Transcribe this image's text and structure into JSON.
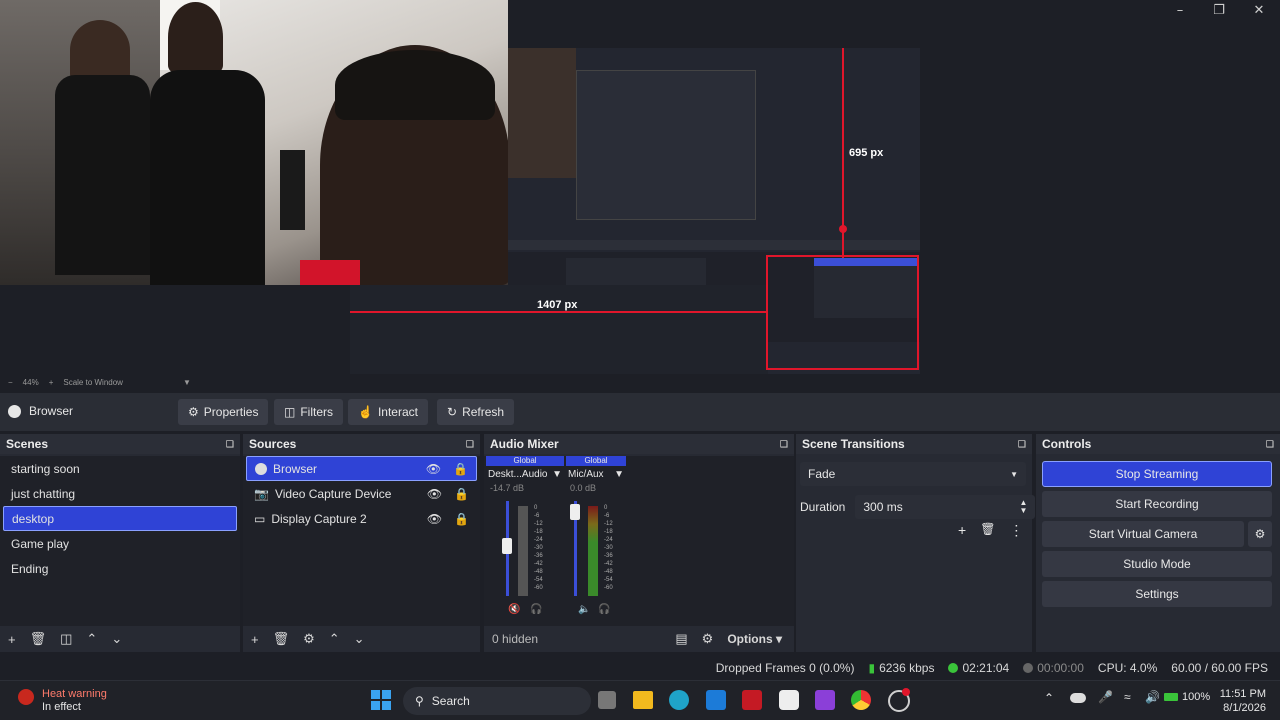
{
  "preview": {
    "px_label_top": "695 px",
    "px_label_left": "1407 px",
    "zoom": "44%",
    "zoom_mode": "Scale to Window"
  },
  "source_toolbar": {
    "source_name": "Browser",
    "properties": "Properties",
    "filters": "Filters",
    "interact": "Interact",
    "refresh": "Refresh"
  },
  "scenes": {
    "title": "Scenes",
    "items": [
      {
        "label": "starting soon"
      },
      {
        "label": "just chatting"
      },
      {
        "label": "desktop",
        "selected": true
      },
      {
        "label": "Game play"
      },
      {
        "label": "Ending"
      }
    ]
  },
  "sources": {
    "title": "Sources",
    "items": [
      {
        "label": "Browser",
        "icon": "globe-icon",
        "selected": true
      },
      {
        "label": "Video Capture Device",
        "icon": "camera-icon"
      },
      {
        "label": "Display Capture 2",
        "icon": "monitor-icon"
      }
    ]
  },
  "mixer": {
    "title": "Audio Mixer",
    "channels": [
      {
        "global": "Global",
        "name": "Deskt...Audio",
        "db": "-14.7 dB",
        "muted": true
      },
      {
        "global": "Global",
        "name": "Mic/Aux",
        "db": "0.0 dB",
        "muted": false
      }
    ],
    "scale": [
      "0",
      "-6",
      "-12",
      "-18",
      "-24",
      "-30",
      "-36",
      "-42",
      "-48",
      "-54",
      "-60"
    ],
    "hidden": "0 hidden",
    "options": "Options"
  },
  "transitions": {
    "title": "Scene Transitions",
    "selected": "Fade",
    "duration_label": "Duration",
    "duration_value": "300 ms"
  },
  "controls": {
    "title": "Controls",
    "stop_streaming": "Stop Streaming",
    "start_recording": "Start Recording",
    "start_virtual_camera": "Start Virtual Camera",
    "studio_mode": "Studio Mode",
    "settings": "Settings"
  },
  "status": {
    "dropped_frames": "Dropped Frames 0 (0.0%)",
    "bitrate": "6236 kbps",
    "stream_time": "02:21:04",
    "record_time": "00:00:00",
    "cpu": "CPU: 4.0%",
    "fps": "60.00 / 60.00 FPS"
  },
  "taskbar": {
    "heat_title": "Heat warning",
    "heat_sub": "In effect",
    "search": "Search",
    "battery": "100%",
    "time": "11:51 PM",
    "date": "8/1/2026"
  },
  "colors": {
    "accent": "#2f43d6",
    "red": "#e0162b",
    "bg": "#1d1f26"
  }
}
